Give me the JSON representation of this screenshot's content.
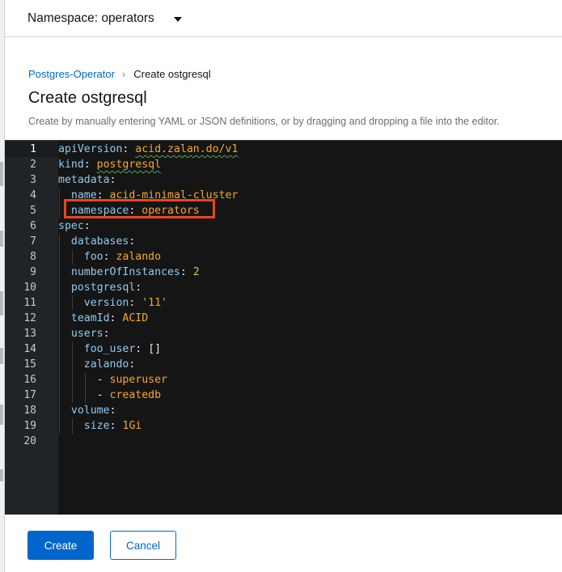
{
  "namespace": {
    "label": "Namespace: operators"
  },
  "breadcrumb": {
    "parent": "Postgres-Operator",
    "separator": "›",
    "current": "Create ostgresql"
  },
  "page": {
    "title": "Create ostgresql",
    "help": "Create by manually entering YAML or JSON definitions, or by dragging and dropping a file into the editor."
  },
  "editor": {
    "active_line": 1,
    "highlighted_line": 5,
    "highlight_color": "#e9471a",
    "lines": [
      {
        "n": "1",
        "indent": "",
        "key": "apiVersion",
        "sep": ": ",
        "val": "acid.zalan.do/v1",
        "type": "v",
        "squiggle": true
      },
      {
        "n": "2",
        "indent": "",
        "key": "kind",
        "sep": ": ",
        "val": "postgresql",
        "type": "v",
        "squiggle": true
      },
      {
        "n": "3",
        "indent": "",
        "key": "metadata",
        "sep": ":",
        "val": "",
        "type": "v"
      },
      {
        "n": "4",
        "indent": "  ",
        "key": "name",
        "sep": ": ",
        "val": "acid-minimal-cluster",
        "type": "v"
      },
      {
        "n": "5",
        "indent": "  ",
        "key": "namespace",
        "sep": ": ",
        "val": "operators",
        "type": "v"
      },
      {
        "n": "6",
        "indent": "",
        "key": "spec",
        "sep": ":",
        "val": "",
        "type": "v"
      },
      {
        "n": "7",
        "indent": "  ",
        "key": "databases",
        "sep": ":",
        "val": "",
        "type": "v"
      },
      {
        "n": "8",
        "indent": "    ",
        "key": "foo",
        "sep": ": ",
        "val": "zalando",
        "type": "v"
      },
      {
        "n": "9",
        "indent": "  ",
        "key": "numberOfInstances",
        "sep": ": ",
        "val": "2",
        "type": "n"
      },
      {
        "n": "10",
        "indent": "  ",
        "key": "postgresql",
        "sep": ":",
        "val": "",
        "type": "v"
      },
      {
        "n": "11",
        "indent": "    ",
        "key": "version",
        "sep": ": ",
        "val": "'11'",
        "type": "v"
      },
      {
        "n": "12",
        "indent": "  ",
        "key": "teamId",
        "sep": ": ",
        "val": "ACID",
        "type": "v"
      },
      {
        "n": "13",
        "indent": "  ",
        "key": "users",
        "sep": ":",
        "val": "",
        "type": "v"
      },
      {
        "n": "14",
        "indent": "    ",
        "key": "foo_user",
        "sep": ": ",
        "val": "[]",
        "type": "p"
      },
      {
        "n": "15",
        "indent": "    ",
        "key": "zalando",
        "sep": ":",
        "val": "",
        "type": "v"
      },
      {
        "n": "16",
        "indent": "      ",
        "key": "",
        "sep": "- ",
        "val": "superuser",
        "type": "v"
      },
      {
        "n": "17",
        "indent": "      ",
        "key": "",
        "sep": "- ",
        "val": "createdb",
        "type": "v"
      },
      {
        "n": "18",
        "indent": "  ",
        "key": "volume",
        "sep": ":",
        "val": "",
        "type": "v"
      },
      {
        "n": "19",
        "indent": "    ",
        "key": "size",
        "sep": ": ",
        "val": "1Gi",
        "type": "v"
      },
      {
        "n": "20",
        "indent": "",
        "key": "",
        "sep": "",
        "val": "",
        "type": "v"
      }
    ]
  },
  "actions": {
    "create": "Create",
    "cancel": "Cancel"
  },
  "colors": {
    "primary": "#0066cc",
    "editor_bg": "#151515",
    "gutter_bg": "#212427",
    "key": "#8ecbf0",
    "value": "#f4a72a",
    "number": "#a6e22e"
  }
}
